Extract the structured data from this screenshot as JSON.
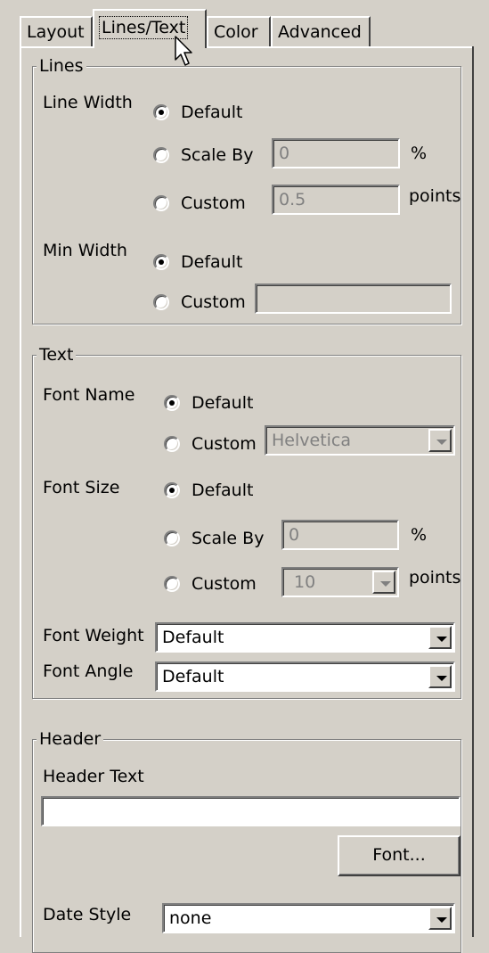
{
  "tabs": [
    {
      "label": "Layout",
      "active": false
    },
    {
      "label": "Lines/Text",
      "active": true
    },
    {
      "label": "Color",
      "active": false
    },
    {
      "label": "Advanced",
      "active": false
    }
  ],
  "lines": {
    "title": "Lines",
    "line_width": {
      "label": "Line Width",
      "default_label": "Default",
      "scale_label": "Scale By",
      "scale_value": "0",
      "scale_unit": "%",
      "custom_label": "Custom",
      "custom_value": "0.5",
      "custom_unit": "points",
      "selected": "default"
    },
    "min_width": {
      "label": "Min Width",
      "default_label": "Default",
      "custom_label": "Custom",
      "custom_value": "",
      "selected": "default"
    }
  },
  "text": {
    "title": "Text",
    "font_name": {
      "label": "Font Name",
      "default_label": "Default",
      "custom_label": "Custom",
      "custom_value": "Helvetica",
      "selected": "default"
    },
    "font_size": {
      "label": "Font Size",
      "default_label": "Default",
      "scale_label": "Scale By",
      "scale_value": "0",
      "scale_unit": "%",
      "custom_label": "Custom",
      "custom_value": "10",
      "custom_unit": "points",
      "selected": "default"
    },
    "font_weight": {
      "label": "Font Weight",
      "value": "Default"
    },
    "font_angle": {
      "label": "Font Angle",
      "value": "Default"
    }
  },
  "header": {
    "title": "Header",
    "header_text_label": "Header Text",
    "header_text_value": "",
    "font_button_label": "Font...",
    "date_style_label": "Date Style",
    "date_style_value": "none"
  },
  "icons": {
    "cursor": "arrow-cursor-icon",
    "dropdown": "chevron-down-icon"
  },
  "colors": {
    "face": "#d4d0c8",
    "shadow": "#808080",
    "highlight": "#ffffff",
    "disabled_text": "#808080"
  }
}
